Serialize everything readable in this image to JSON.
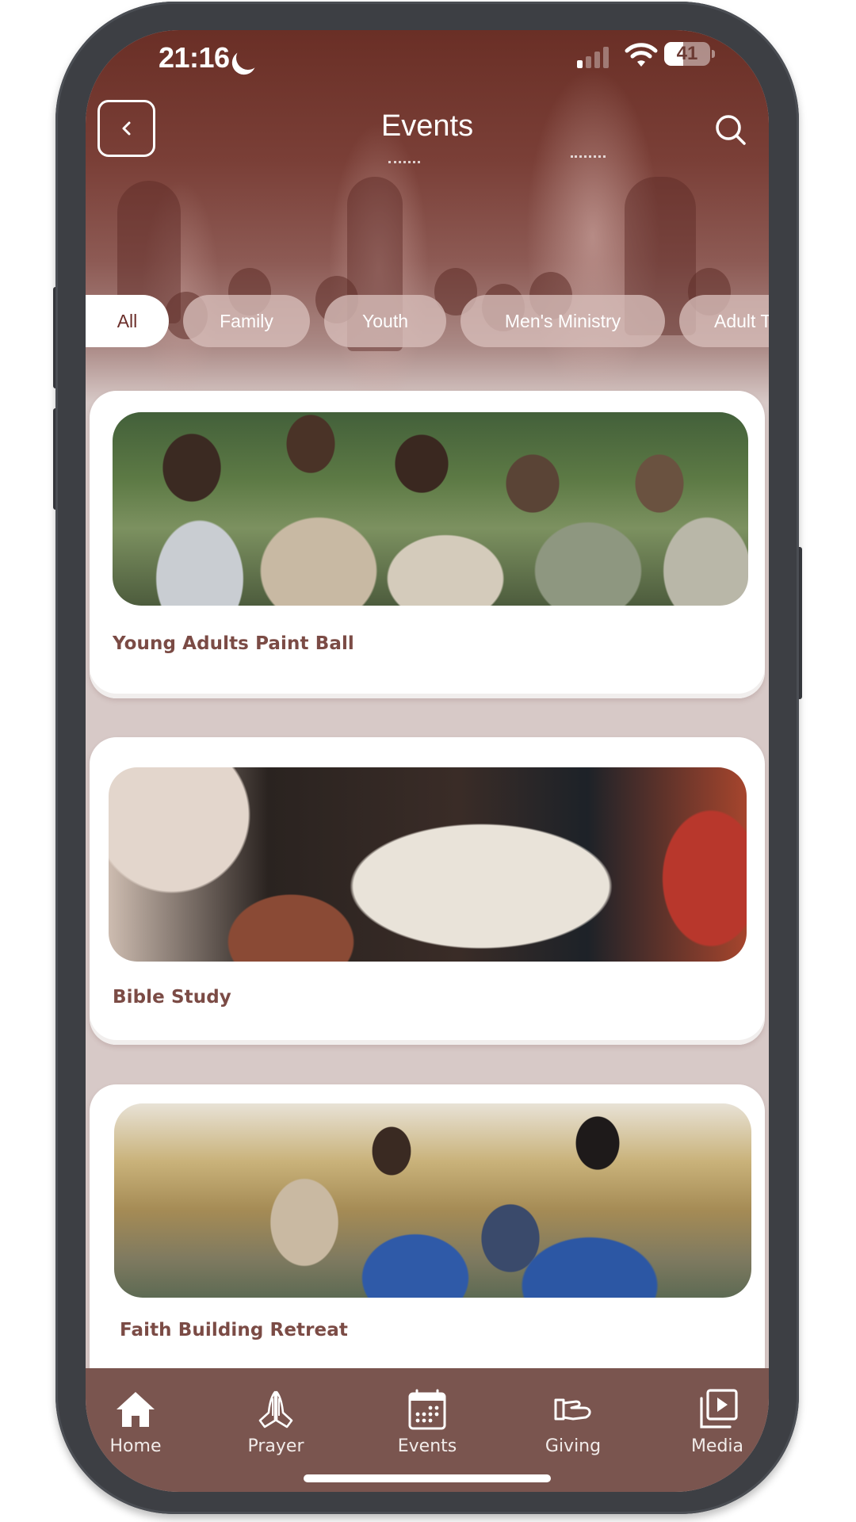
{
  "status_bar": {
    "time": "21:16",
    "battery": "41",
    "battery_level_percent": 41,
    "icons": [
      "moon-icon",
      "signal-icon",
      "wifi-icon",
      "battery-icon"
    ]
  },
  "header": {
    "title": "Events",
    "back_icon": "chevron-left-icon",
    "search_icon": "search-icon"
  },
  "filters": {
    "chips": [
      {
        "label": "All",
        "active": true
      },
      {
        "label": "Family",
        "active": false
      },
      {
        "label": "Youth",
        "active": false
      },
      {
        "label": "Men's Ministry",
        "active": false
      },
      {
        "label": "Adult T",
        "active": false
      }
    ]
  },
  "events": [
    {
      "title": "Young Adults Paint Ball",
      "image": "group of young adults embracing outdoors after paintball"
    },
    {
      "title": "Bible Study",
      "image": "open bible on a lap"
    },
    {
      "title": "Faith Building Retreat",
      "image": "smiling people in blue shirts outdoors"
    }
  ],
  "bottom_nav": {
    "items": [
      {
        "label": "Home",
        "icon": "home-icon"
      },
      {
        "label": "Prayer",
        "icon": "praying-hands-icon"
      },
      {
        "label": "Events",
        "icon": "calendar-icon"
      },
      {
        "label": "Giving",
        "icon": "giving-hand-icon"
      },
      {
        "label": "Media",
        "icon": "media-play-icon"
      }
    ]
  },
  "colors": {
    "brand": "#6b2e2a",
    "nav_background": "#7a554f",
    "card_title": "#7b4b45",
    "page_background": "#d7c9c7"
  }
}
